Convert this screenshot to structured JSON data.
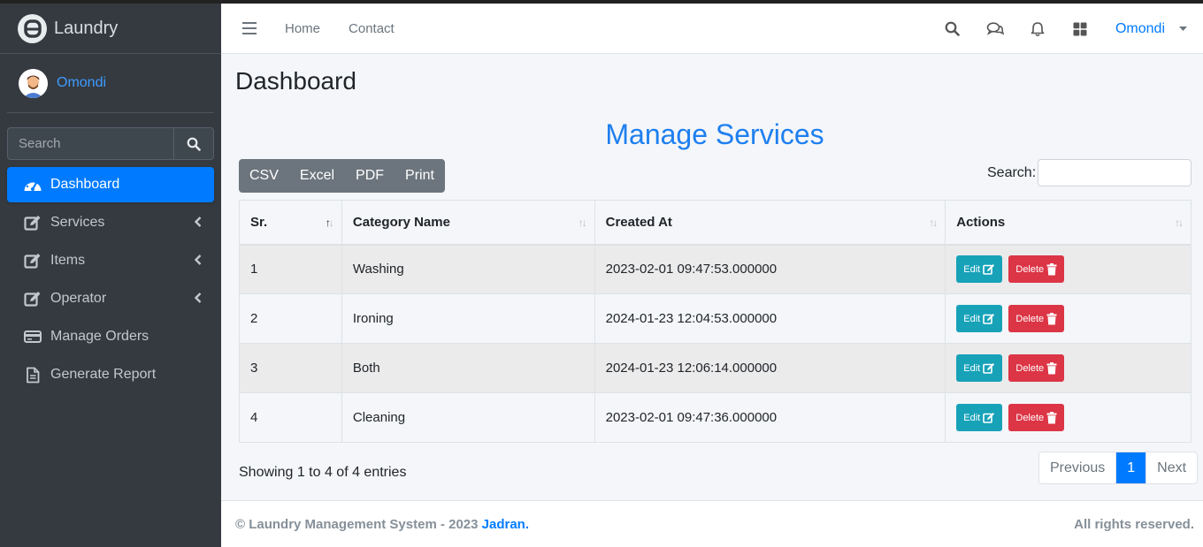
{
  "brand": {
    "name": "Laundry"
  },
  "user": {
    "name": "Omondi"
  },
  "sidebar": {
    "search_placeholder": "Search",
    "items": [
      {
        "label": "Dashboard",
        "icon": "tachometer-icon",
        "active": true,
        "has_caret": false
      },
      {
        "label": "Services",
        "icon": "edit-icon",
        "active": false,
        "has_caret": true
      },
      {
        "label": "Items",
        "icon": "edit-icon",
        "active": false,
        "has_caret": true
      },
      {
        "label": "Operator",
        "icon": "edit-icon",
        "active": false,
        "has_caret": true
      },
      {
        "label": "Manage Orders",
        "icon": "credit-card-icon",
        "active": false,
        "has_caret": false
      },
      {
        "label": "Generate Report",
        "icon": "file-icon",
        "active": false,
        "has_caret": false
      }
    ]
  },
  "header": {
    "nav": [
      "Home",
      "Contact"
    ],
    "user_name": "Omondi"
  },
  "page": {
    "title": "Dashboard",
    "section_title": "Manage Services",
    "export_buttons": [
      "CSV",
      "Excel",
      "PDF",
      "Print"
    ],
    "search_label": "Search:",
    "table": {
      "columns": [
        "Sr.",
        "Category Name",
        "Created At",
        "Actions"
      ],
      "rows": [
        {
          "sr": "1",
          "category": "Washing",
          "created": "2023-02-01 09:47:53.000000"
        },
        {
          "sr": "2",
          "category": "Ironing",
          "created": "2024-01-23 12:04:53.000000"
        },
        {
          "sr": "3",
          "category": "Both",
          "created": "2024-01-23 12:06:14.000000"
        },
        {
          "sr": "4",
          "category": "Cleaning",
          "created": "2023-02-01 09:47:36.000000"
        }
      ],
      "edit_label": "Edit",
      "delete_label": "Delete"
    },
    "info": "Showing 1 to 4 of 4 entries",
    "pagination": {
      "previous": "Previous",
      "current": "1",
      "next": "Next"
    }
  },
  "footer": {
    "copyright": "© Laundry Management System - 2023",
    "brand": "Jadran.",
    "rights": "All rights reserved."
  },
  "colors": {
    "primary": "#007bff",
    "sidebar": "#343a40",
    "info": "#17a2b8",
    "danger": "#dc3545",
    "secondary": "#6c757d"
  }
}
